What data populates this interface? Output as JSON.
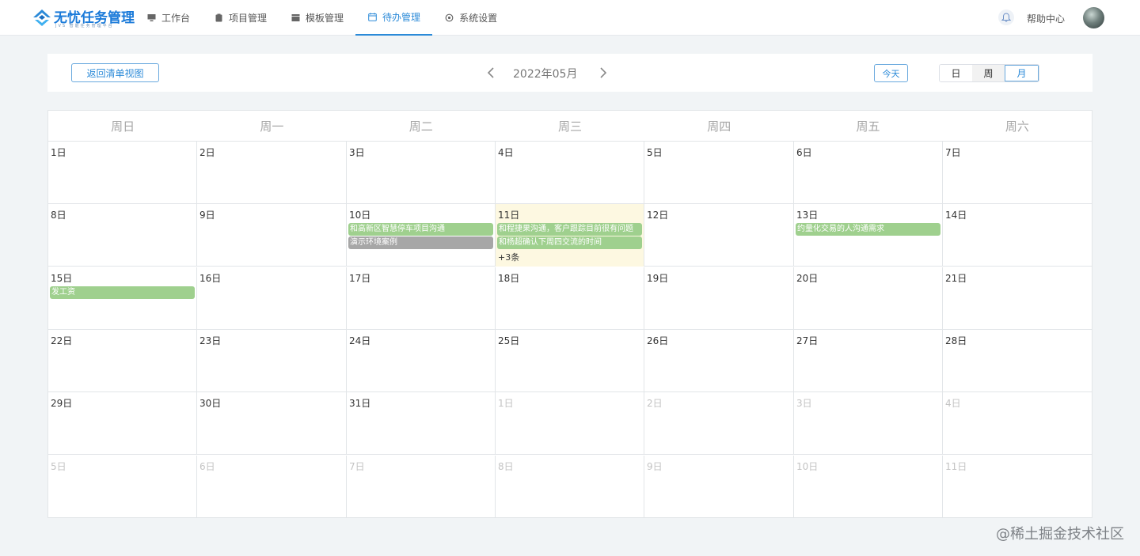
{
  "app": {
    "logo_title": "无忧任务管理",
    "logo_sub": "JVS 智能任务管理平台"
  },
  "nav": {
    "items": [
      {
        "label": "工作台",
        "icon": "monitor-icon"
      },
      {
        "label": "项目管理",
        "icon": "clipboard-icon"
      },
      {
        "label": "模板管理",
        "icon": "template-icon"
      },
      {
        "label": "待办管理",
        "icon": "calendar-icon",
        "active": true
      },
      {
        "label": "系统设置",
        "icon": "gear-icon"
      }
    ],
    "help_label": "帮助中心"
  },
  "toolbar": {
    "back_label": "返回清单视图",
    "month_label": "2022年05月",
    "today_label": "今天",
    "views": [
      "日",
      "周",
      "月"
    ],
    "selected_view": "月"
  },
  "calendar": {
    "weekdays": [
      "周日",
      "周一",
      "周二",
      "周三",
      "周四",
      "周五",
      "周六"
    ],
    "today": "11日",
    "weeks": [
      [
        {
          "d": "1日"
        },
        {
          "d": "2日"
        },
        {
          "d": "3日"
        },
        {
          "d": "4日"
        },
        {
          "d": "5日"
        },
        {
          "d": "6日"
        },
        {
          "d": "7日"
        }
      ],
      [
        {
          "d": "8日"
        },
        {
          "d": "9日"
        },
        {
          "d": "10日",
          "events": [
            {
              "t": "和高新区智慧停车项目沟通",
              "c": "green"
            },
            {
              "t": "演示环境案例",
              "c": "gray"
            }
          ]
        },
        {
          "d": "11日",
          "today": true,
          "events": [
            {
              "t": "和程捷果沟通，客户跟踪目前很有问题",
              "c": "green"
            },
            {
              "t": "和杨超确认下周四交流的时间",
              "c": "green"
            }
          ],
          "more": "+3条"
        },
        {
          "d": "12日"
        },
        {
          "d": "13日",
          "events": [
            {
              "t": "约量化交易的人沟通需求",
              "c": "green"
            }
          ]
        },
        {
          "d": "14日"
        }
      ],
      [
        {
          "d": "15日",
          "events": [
            {
              "t": "发工资",
              "c": "green"
            }
          ]
        },
        {
          "d": "16日"
        },
        {
          "d": "17日"
        },
        {
          "d": "18日"
        },
        {
          "d": "19日"
        },
        {
          "d": "20日"
        },
        {
          "d": "21日"
        }
      ],
      [
        {
          "d": "22日"
        },
        {
          "d": "23日"
        },
        {
          "d": "24日"
        },
        {
          "d": "25日"
        },
        {
          "d": "26日"
        },
        {
          "d": "27日"
        },
        {
          "d": "28日"
        }
      ],
      [
        {
          "d": "29日"
        },
        {
          "d": "30日"
        },
        {
          "d": "31日"
        },
        {
          "d": "1日",
          "other": true
        },
        {
          "d": "2日",
          "other": true
        },
        {
          "d": "3日",
          "other": true
        },
        {
          "d": "4日",
          "other": true
        }
      ],
      [
        {
          "d": "5日",
          "other": true
        },
        {
          "d": "6日",
          "other": true
        },
        {
          "d": "7日",
          "other": true
        },
        {
          "d": "8日",
          "other": true
        },
        {
          "d": "9日",
          "other": true
        },
        {
          "d": "10日",
          "other": true
        },
        {
          "d": "11日",
          "other": true
        }
      ]
    ]
  },
  "colors": {
    "accent": "#2b8ad8",
    "event_green": "#9fd08e",
    "event_gray": "#a7a7a7",
    "today_bg": "#fdf8e1"
  },
  "watermark": "@稀土掘金技术社区"
}
